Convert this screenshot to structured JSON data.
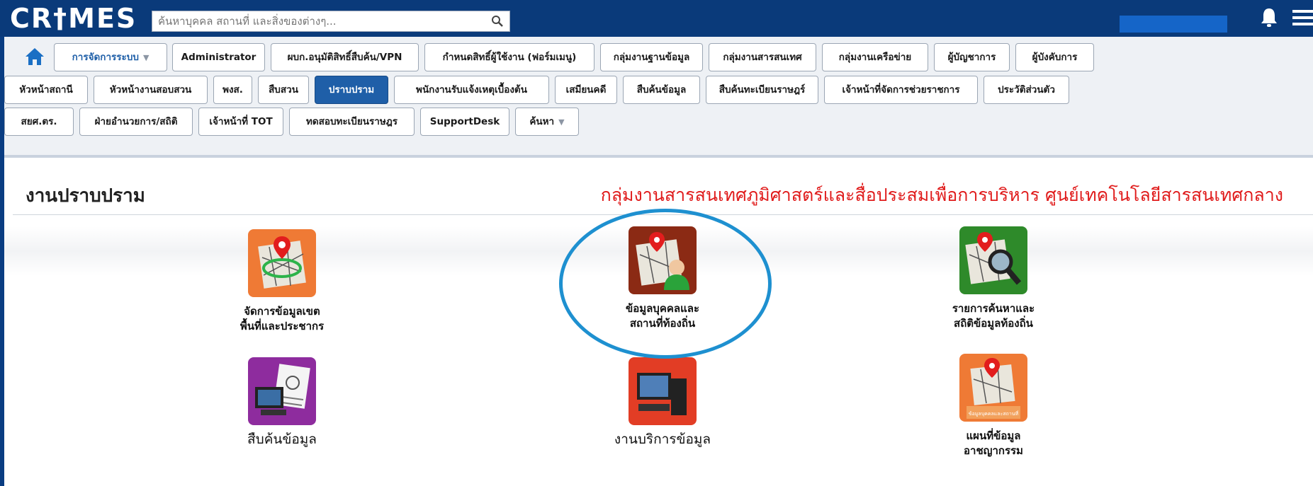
{
  "header": {
    "logo": "CR†MES",
    "search": {
      "placeholder": "ค้นหาบุคคล สถานที่ และสิ่งของต่างๆ..."
    }
  },
  "nav": {
    "row1": [
      "การจัดการระบบ",
      "Administrator",
      "ผบก.อนุมัติสิทธิ์สืบค้น/VPN",
      "กำหนดสิทธิ์ผู้ใช้งาน (ฟอร์มเมนู)",
      "กลุ่มงานฐานข้อมูล",
      "กลุ่มงานสารสนเทศ",
      "กลุ่มงานเครือข่าย",
      "ผู้บัญชาการ",
      "ผู้บังคับการ"
    ],
    "row2": [
      "หัวหน้าสถานี",
      "หัวหน้างานสอบสวน",
      "พงส.",
      "สืบสวน",
      "ปราบปราม",
      "พนักงานรับแจ้งเหตุเบื้องต้น",
      "เสมียนคดี",
      "สืบค้นข้อมูล",
      "สืบค้นทะเบียนราษฎร์",
      "เจ้าหน้าที่จัดการช่วยราชการ",
      "ประวัติส่วนตัว"
    ],
    "row3": [
      "สยศ.ตร.",
      "ฝ่ายอำนวยการ/สถิติ",
      "เจ้าหน้าที่ TOT",
      "ทดสอบทะเบียนราษฎร",
      "SupportDesk",
      "ค้นหา"
    ],
    "active": "ปราบปราม"
  },
  "main": {
    "title": "งานปราบปราม",
    "subtitle": "กลุ่มงานสารสนเทศภูมิศาสตร์และสื่อประสมเพื่อการบริหาร ศูนย์เทคโนโลยีสารสนเทศกลาง",
    "tiles": [
      {
        "line1": "จัดการข้อมูลเขต",
        "line2": "พื้นที่และประชากร",
        "icon": "map-zone-icon"
      },
      {
        "line1": "ข้อมูลบุคคลและ",
        "line2": "สถานที่ท้องถิ่น",
        "icon": "map-person-icon"
      },
      {
        "line1": "รายการค้นหาและ",
        "line2": "สถิติข้อมูลท้องถิ่น",
        "icon": "map-search-icon"
      },
      {
        "line1": "สืบค้นข้อมูล",
        "line2": "",
        "icon": "document-computer-icon"
      },
      {
        "line1": "งานบริการข้อมูล",
        "line2": "",
        "icon": "computer-icon"
      },
      {
        "line1": "แผนที่ข้อมูล",
        "line2": "อาชญากรรม",
        "icon": "crime-map-icon",
        "badge": "ข้อมูลบุคคลและสถานที่"
      }
    ]
  },
  "colors": {
    "header": "#0a3a7a",
    "active": "#1f5fa8",
    "subtitle": "#e01b1b",
    "highlight": "#1e90d0"
  }
}
